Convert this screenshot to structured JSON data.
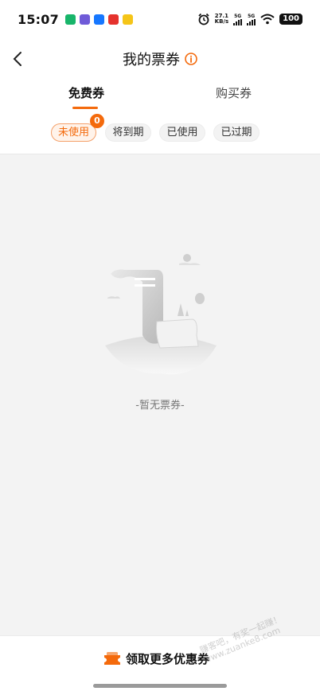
{
  "status_bar": {
    "time": "15:07",
    "net_speed_value": "27.1",
    "net_speed_unit": "KB/s",
    "signal1_label": "5G",
    "signal2_label": "5G",
    "battery": "100"
  },
  "header": {
    "title": "我的票券"
  },
  "tabs": [
    {
      "label": "免费券",
      "active": true
    },
    {
      "label": "购买券",
      "active": false
    }
  ],
  "filters": [
    {
      "label": "未使用",
      "active": true
    },
    {
      "label": "将到期",
      "active": false
    },
    {
      "label": "已使用",
      "active": false
    },
    {
      "label": "已过期",
      "active": false
    }
  ],
  "unused_badge": "0",
  "empty_state": {
    "text": "-暂无票券-"
  },
  "bottom": {
    "claim_label": "领取更多优惠券"
  },
  "watermark": {
    "line1": "赚客吧，有奖一起赚！",
    "line2": "www.zuanke8.com"
  },
  "colors": {
    "accent": "#f46a0c",
    "background": "#f3f3f3"
  }
}
